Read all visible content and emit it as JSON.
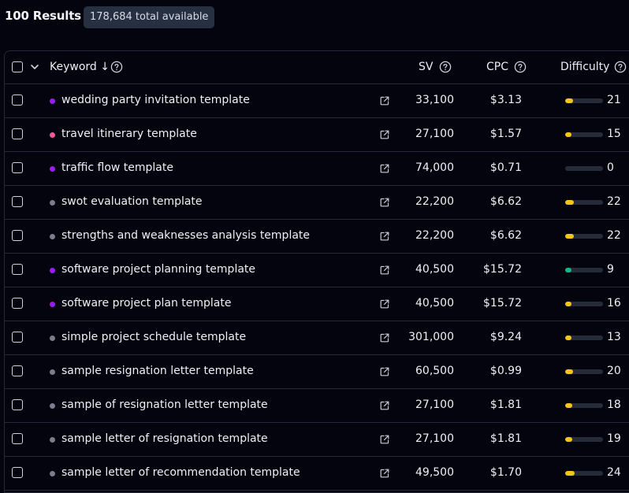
{
  "header": {
    "results_title": "100 Results",
    "total_badge": "178,684 total available"
  },
  "table": {
    "columns": {
      "keyword": "Keyword ↓",
      "sv": "SV",
      "cpc": "CPC",
      "difficulty": "Difficulty"
    },
    "rows": [
      {
        "keyword": "wedding party invitation template",
        "sv": "33,100",
        "cpc": "$3.13",
        "difficulty": "21",
        "difficulty_value": 21,
        "dot_color": "#9b1cf0"
      },
      {
        "keyword": "travel itinerary template",
        "sv": "27,100",
        "cpc": "$1.57",
        "difficulty": "15",
        "difficulty_value": 15,
        "dot_color": "#f0589a"
      },
      {
        "keyword": "traffic flow template",
        "sv": "74,000",
        "cpc": "$0.71",
        "difficulty": "0",
        "difficulty_value": 0,
        "dot_color": "#9b1cf0"
      },
      {
        "keyword": "swot evaluation template",
        "sv": "22,200",
        "cpc": "$6.62",
        "difficulty": "22",
        "difficulty_value": 22,
        "dot_color": "#7a7d8c"
      },
      {
        "keyword": "strengths and weaknesses analysis template",
        "sv": "22,200",
        "cpc": "$6.62",
        "difficulty": "22",
        "difficulty_value": 22,
        "dot_color": "#7a7d8c"
      },
      {
        "keyword": "software project planning template",
        "sv": "40,500",
        "cpc": "$15.72",
        "difficulty": "9",
        "difficulty_value": 9,
        "dot_color": "#9b1cf0"
      },
      {
        "keyword": "software project plan template",
        "sv": "40,500",
        "cpc": "$15.72",
        "difficulty": "16",
        "difficulty_value": 16,
        "dot_color": "#9b1cf0"
      },
      {
        "keyword": "simple project schedule template",
        "sv": "301,000",
        "cpc": "$9.24",
        "difficulty": "13",
        "difficulty_value": 13,
        "dot_color": "#7a7d8c"
      },
      {
        "keyword": "sample resignation letter template",
        "sv": "60,500",
        "cpc": "$0.99",
        "difficulty": "20",
        "difficulty_value": 20,
        "dot_color": "#7a7d8c"
      },
      {
        "keyword": "sample of resignation letter template",
        "sv": "27,100",
        "cpc": "$1.81",
        "difficulty": "18",
        "difficulty_value": 18,
        "dot_color": "#7a7d8c"
      },
      {
        "keyword": "sample letter of resignation template",
        "sv": "27,100",
        "cpc": "$1.81",
        "difficulty": "19",
        "difficulty_value": 19,
        "dot_color": "#7a7d8c"
      },
      {
        "keyword": "sample letter of recommendation template",
        "sv": "49,500",
        "cpc": "$1.70",
        "difficulty": "24",
        "difficulty_value": 24,
        "dot_color": "#7a7d8c"
      }
    ]
  },
  "colors": {
    "difficulty_easy": "#12b886",
    "difficulty_medium": "#f5c518",
    "bar_track": "#262b39"
  },
  "icons": {
    "help": "question-circle-icon",
    "external": "external-link-icon",
    "chevron": "chevron-down-icon"
  }
}
